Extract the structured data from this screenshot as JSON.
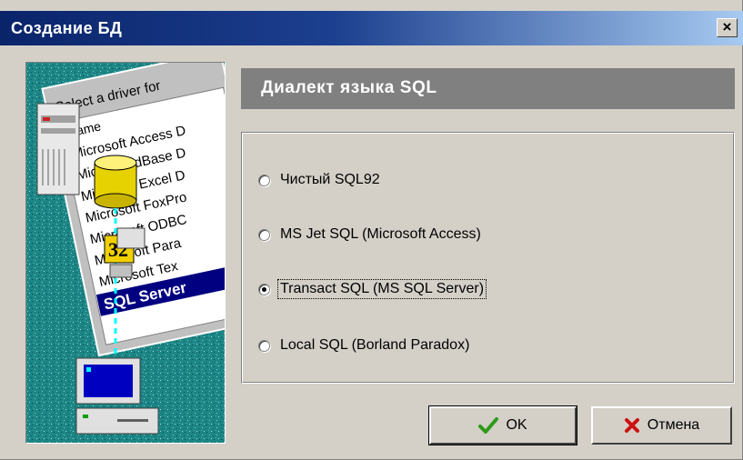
{
  "window": {
    "title": "Создание БД",
    "close_label": "×"
  },
  "illustration": {
    "list_header": "Select a driver for",
    "column_header": "Name",
    "list_items": [
      "Microsoft Access D",
      "Microsoft dBase D",
      "Microsoft Excel D",
      "Microsoft FoxPro",
      "Microsoft ODBC",
      "Microsoft Para",
      "Microsoft Tex",
      "SQL Server"
    ],
    "badge": "32"
  },
  "header": {
    "title": "Диалект языка SQL"
  },
  "dialects": {
    "selected_index": 2,
    "options": [
      {
        "label": "Чистый SQL92"
      },
      {
        "label": "MS Jet SQL (Microsoft Access)"
      },
      {
        "label": "Transact SQL (MS SQL Server)"
      },
      {
        "label": "Local SQL (Borland Paradox)"
      }
    ]
  },
  "buttons": {
    "ok_label": "OK",
    "cancel_label": "Отмена"
  },
  "colors": {
    "title_start": "#0a246a",
    "title_end": "#a6caf0",
    "face": "#d4d0c8",
    "banner": "#808080",
    "ok_check": "#2e9a1a",
    "cancel_x": "#cc1010",
    "art_bg": "#1f8a8a"
  },
  "icons": {
    "ok": "check-icon",
    "cancel": "cross-icon",
    "close": "close-icon"
  }
}
